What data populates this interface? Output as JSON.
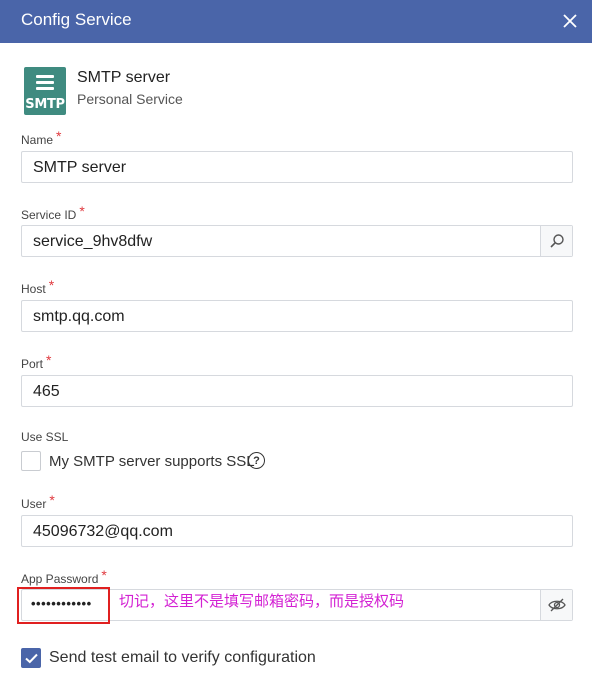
{
  "dialog": {
    "title": "Config Service",
    "close_icon": "close-icon"
  },
  "service": {
    "logo_text": "SMTP",
    "name": "SMTP server",
    "subtitle": "Personal Service",
    "logo_color": "#3f8b80"
  },
  "required_marker": "*",
  "fields": {
    "name": {
      "label": "Name",
      "value": "SMTP server"
    },
    "service_id": {
      "label": "Service ID",
      "value": "service_9hv8dfw",
      "addon_icon": "search-icon"
    },
    "host": {
      "label": "Host",
      "value": "smtp.qq.com"
    },
    "port": {
      "label": "Port",
      "value": "465"
    },
    "use_ssl": {
      "label": "Use SSL",
      "checkbox_label": "My SMTP server supports SSL",
      "checked": false,
      "help_icon": "help-icon",
      "help_glyph": "?"
    },
    "user": {
      "label": "User",
      "value": "45096732@qq.com"
    },
    "app_password": {
      "label": "App Password",
      "masked_value": "••••••••••••",
      "addon_icon": "eye-slash-icon"
    }
  },
  "annotation": {
    "text": "切记，这里不是填写邮箱密码，而是授权码",
    "color": "#d321d3"
  },
  "send_test": {
    "label": "Send test email to verify configuration",
    "checked": true
  },
  "colors": {
    "header": "#4a65a9",
    "required": "#e0393e",
    "highlight_box": "#e02020"
  }
}
